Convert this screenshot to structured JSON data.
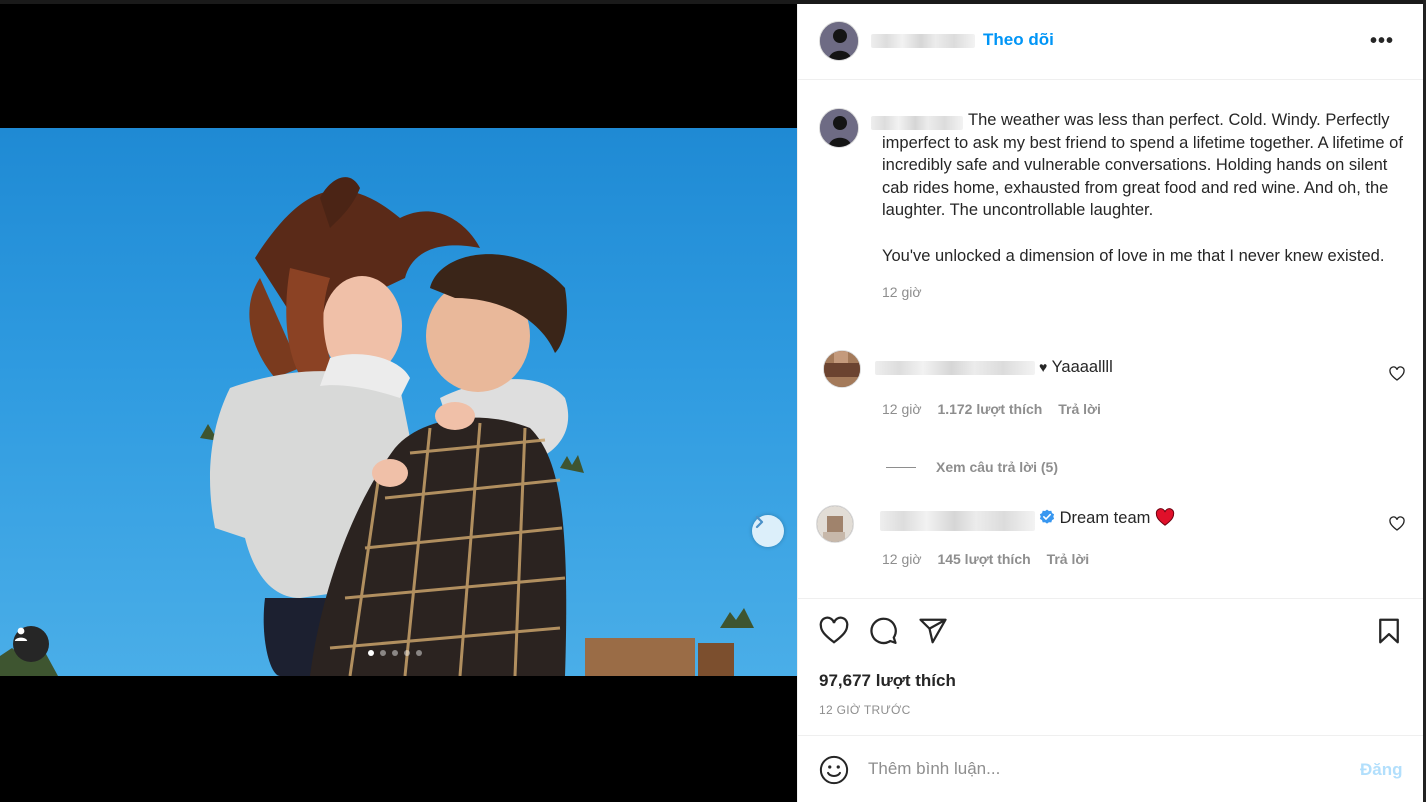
{
  "header": {
    "follow_label": "Theo dõi",
    "more_label": "•••"
  },
  "caption": {
    "paragraph1": "The weather was less than perfect. Cold. Windy. Perfectly imperfect to ask my best friend to spend a lifetime together. A lifetime of incredibly safe and vulnerable conversations. Holding hands on silent cab rides home, exhausted from great food and red wine. And oh, the laughter. The uncontrollable laughter.",
    "paragraph2": "You've unlocked a dimension of love in me that I never knew existed.",
    "time": "12 giờ"
  },
  "comments": [
    {
      "text": "Yaaaallll",
      "prefix_icon": "black-heart",
      "time": "12 giờ",
      "likes": "1.172 lượt thích",
      "reply_label": "Trả lời",
      "view_replies": "Xem câu trả lời (5)"
    },
    {
      "text": "Dream team",
      "verified": true,
      "suffix_icon": "red-heart",
      "time": "12 giờ",
      "likes": "145 lượt thích",
      "reply_label": "Trả lời"
    }
  ],
  "post": {
    "likes": "97,677 lượt thích",
    "time_ago": "12 GIỜ TRƯỚC"
  },
  "add_comment": {
    "placeholder": "Thêm bình luận...",
    "post_label": "Đăng"
  },
  "carousel": {
    "current": 1,
    "total": 5
  },
  "colors": {
    "accent": "#0095f6",
    "muted": "#8e8e8e",
    "text": "#262626",
    "post_disabled": "#b2dffc",
    "verified": "#3897f0",
    "heart_red": "#ed4956"
  },
  "icons": [
    "chevron-right-icon",
    "user-tag-icon",
    "heart-icon",
    "comment-icon",
    "share-icon",
    "bookmark-icon",
    "emoji-icon",
    "verified-icon"
  ]
}
